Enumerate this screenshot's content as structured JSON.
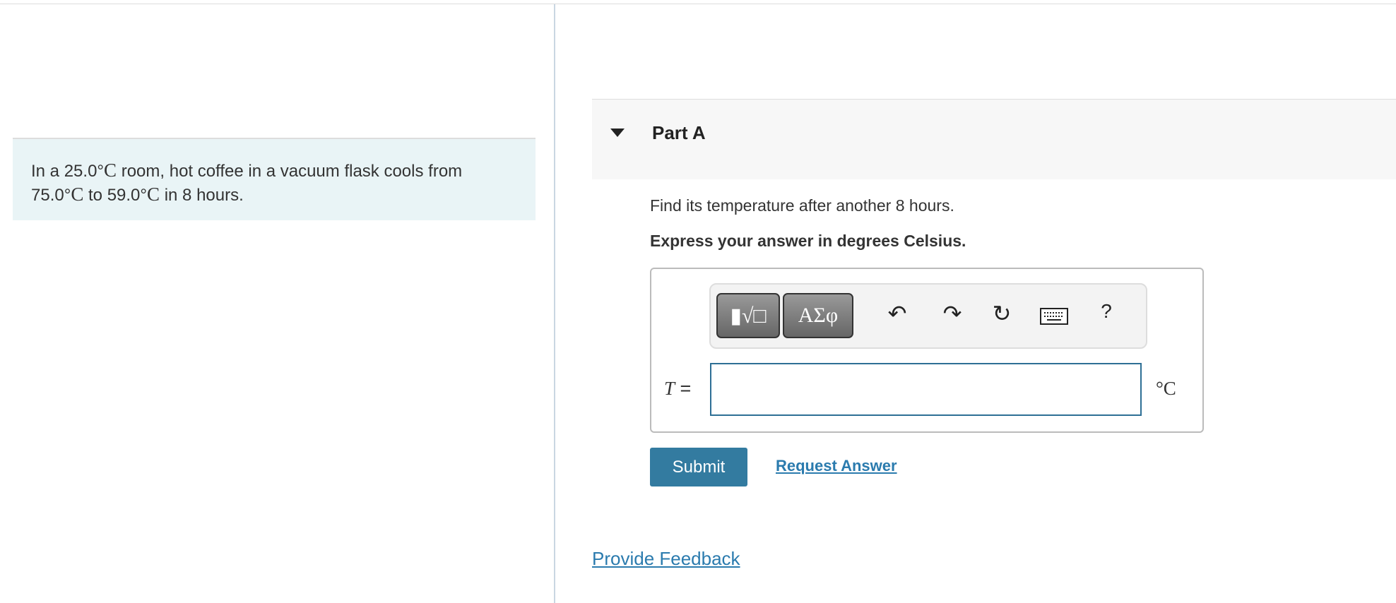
{
  "problem": {
    "p1": "In a 25.0",
    "deg1": "°",
    "C1": "C",
    "p2": " room, hot coffee in a vacuum flask cools from",
    "p3": "75.0",
    "deg2": "°",
    "C2": "C",
    "p4": " to 59.0",
    "deg3": "°",
    "C3": "C",
    "p5": " in 8 hours."
  },
  "part": {
    "title": "Part A",
    "question": "Find its temperature after another 8 hours.",
    "instruction": "Express your answer in degrees Celsius."
  },
  "toolbar": {
    "templates_icon": "▮√□",
    "greek_label": "ΑΣφ",
    "undo": "undo-icon",
    "redo": "redo-icon",
    "reset": "reset-icon",
    "keyboard": "keyboard-icon",
    "help_label": "?"
  },
  "answer": {
    "var": "T",
    "eq": " =",
    "value": "",
    "unit": "°C"
  },
  "actions": {
    "submit": "Submit",
    "request": "Request Answer"
  },
  "feedback": "Provide Feedback",
  "colors": {
    "accent": "#337ba0",
    "link": "#2b7bae",
    "intro_bg": "#e9f4f6"
  }
}
